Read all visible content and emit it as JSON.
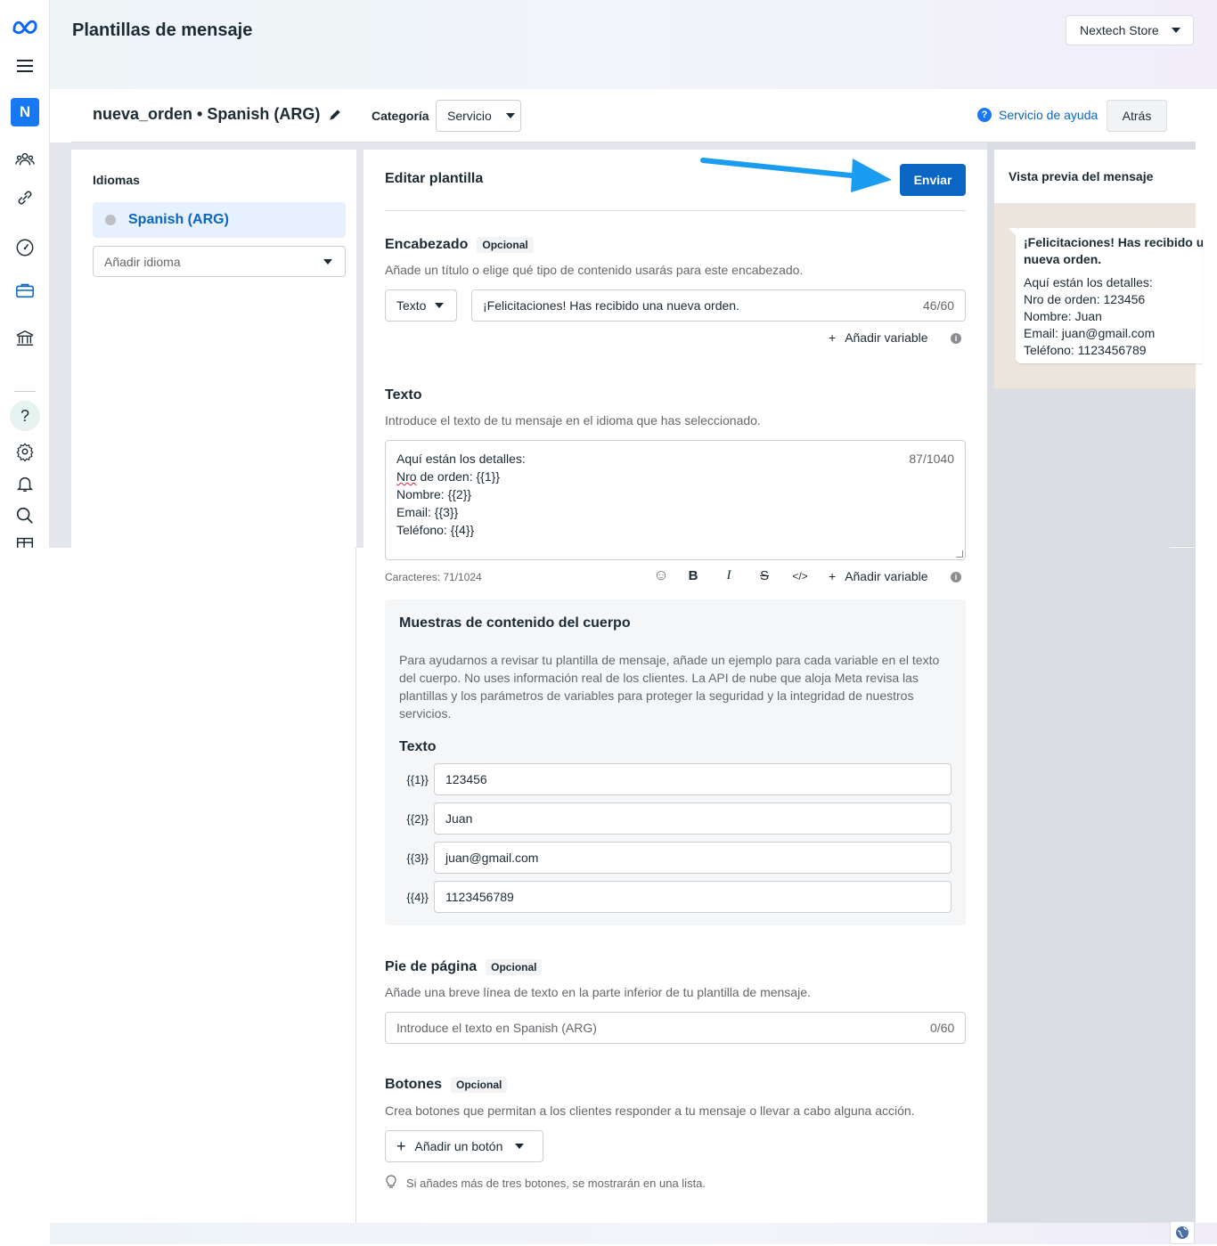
{
  "page": {
    "title": "Plantillas de mensaje"
  },
  "nav": {
    "avatar_letter": "N",
    "icons": [
      "meta-logo-icon",
      "hamburger-icon",
      "people-icon",
      "link-icon",
      "gauge-icon",
      "briefcase-icon",
      "bank-icon",
      "help-icon",
      "gear-icon",
      "bell-icon",
      "search-icon",
      "table-icon"
    ],
    "help_glyph": "?"
  },
  "account": {
    "name": "Nextech Store"
  },
  "template": {
    "name": "nueva_orden • Spanish (ARG)",
    "category_label": "Categoría",
    "category_value": "Servicio",
    "help_link": "Servicio de ayuda",
    "back_label": "Atrás"
  },
  "languages": {
    "title": "Idiomas",
    "selected": "Spanish (ARG)",
    "add_placeholder": "Añadir idioma"
  },
  "editor": {
    "title": "Editar plantilla",
    "send_label": "Enviar",
    "optional_label": "Opcional",
    "add_variable": "Añadir variable",
    "header": {
      "title": "Encabezado",
      "description": "Añade un título o elige qué tipo de contenido usarás para este encabezado.",
      "type": "Texto",
      "value": "¡Felicitaciones! Has recibido una nueva orden.",
      "counter": "46/60"
    },
    "body": {
      "title": "Texto",
      "description": "Introduce el texto de tu mensaje en el idioma que has seleccionado.",
      "lines": [
        "Aquí están los detalles:",
        "Nro",
        " de orden: {{1}}",
        "Nombre: {{2}}",
        "Email: {{3}}",
        "Teléfono: {{4}}"
      ],
      "counter": "87/1040",
      "chars": "Caracteres: 71/1024",
      "format_icons": [
        "emoji-icon",
        "bold-icon",
        "italic-icon",
        "strikethrough-icon",
        "code-icon"
      ],
      "format_glyphs": [
        "☺",
        "B",
        "I",
        "S",
        "</>"
      ]
    },
    "samples": {
      "title": "Muestras de contenido del cuerpo",
      "description": "Para ayudarnos a revisar tu plantilla de mensaje, añade un ejemplo para cada variable en el texto del cuerpo. No uses información real de los clientes. La API de nube que aloja Meta revisa las plantillas y los parámetros de variables para proteger la seguridad y la integridad de nuestros servicios.",
      "subtitle": "Texto",
      "variables": [
        {
          "label": "{{1}}",
          "value": "123456"
        },
        {
          "label": "{{2}}",
          "value": "Juan"
        },
        {
          "label": "{{3}}",
          "value": "juan@gmail.com"
        },
        {
          "label": "{{4}}",
          "value": "1123456789"
        }
      ]
    },
    "footer": {
      "title": "Pie de página",
      "description": "Añade una breve línea de texto en la parte inferior de tu plantilla de mensaje.",
      "placeholder": "Introduce el texto en Spanish (ARG)",
      "counter": "0/60"
    },
    "buttons": {
      "title": "Botones",
      "description": "Crea botones que permitan a los clientes responder a tu mensaje o llevar a cabo alguna acción.",
      "add_label": "Añadir un botón",
      "hint": "Si añades más de tres botones, se mostrarán en una lista."
    }
  },
  "preview": {
    "title": "Vista previa del mensaje",
    "header_line1": "¡Felicitaciones! Has recibido una",
    "header_line2": "nueva orden.",
    "body_lines": [
      "Aquí están los detalles:",
      "Nro de orden: 123456",
      "Nombre: Juan",
      "Email: juan@gmail.com",
      "Teléfono: 1123456789"
    ]
  },
  "colors": {
    "accent": "#0a66c2",
    "arrow": "#1a9cf0",
    "selected_bg": "#e7f0fd"
  }
}
